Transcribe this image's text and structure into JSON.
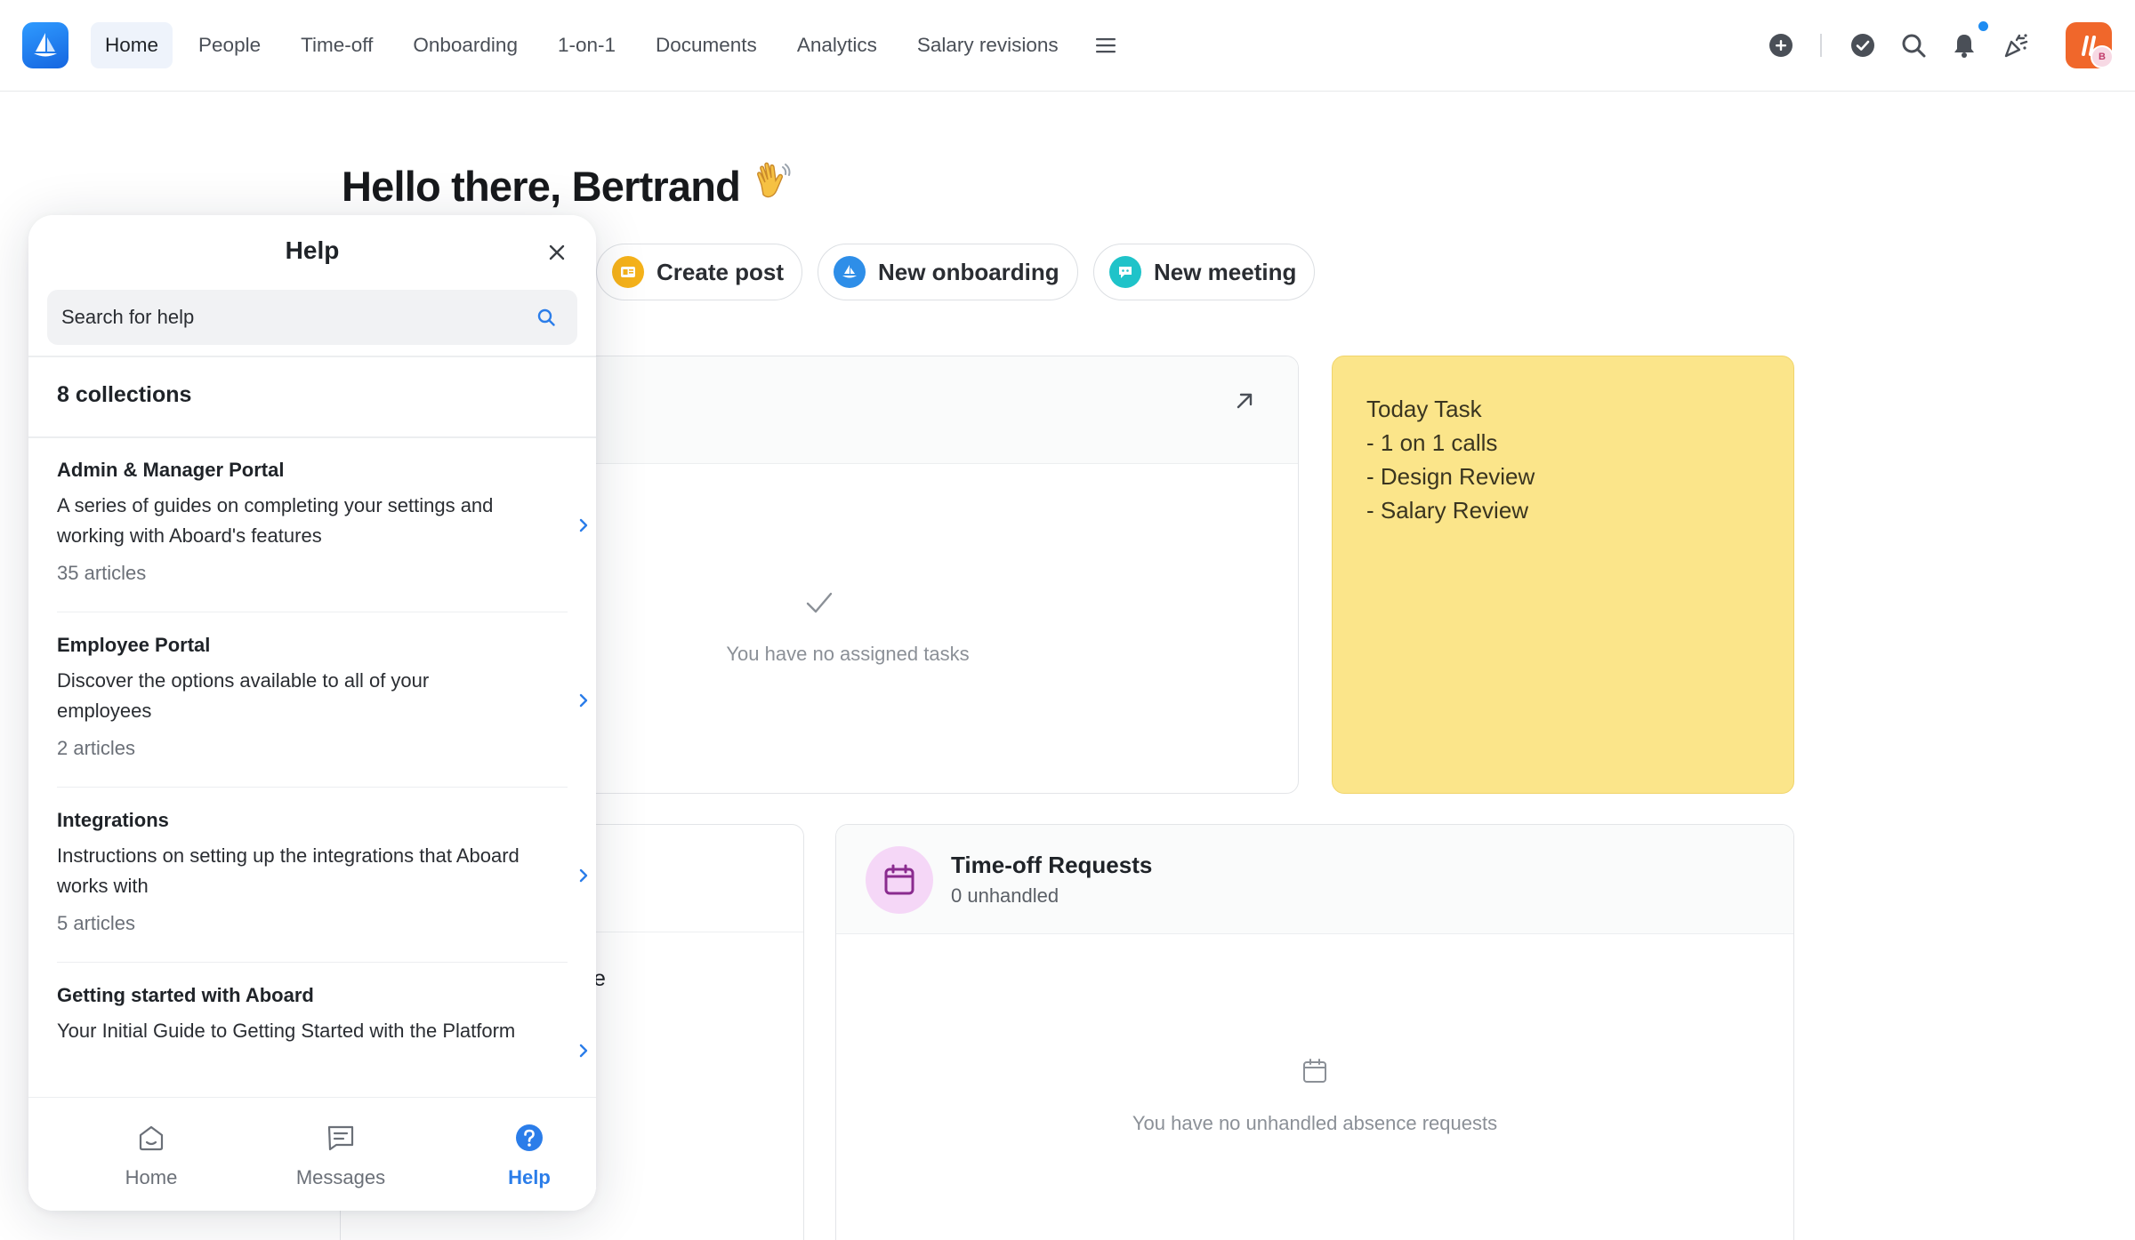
{
  "nav": {
    "items": [
      {
        "label": "Home",
        "active": true
      },
      {
        "label": "People",
        "active": false
      },
      {
        "label": "Time-off",
        "active": false
      },
      {
        "label": "Onboarding",
        "active": false
      },
      {
        "label": "1-on-1",
        "active": false
      },
      {
        "label": "Documents",
        "active": false
      },
      {
        "label": "Analytics",
        "active": false
      },
      {
        "label": "Salary revisions",
        "active": false
      }
    ],
    "icons": [
      "plus-circle-icon",
      "check-circle-icon",
      "search-icon",
      "bell-icon",
      "party-icon"
    ],
    "avatar_badge": "B",
    "accent": "#1e8cf2"
  },
  "main": {
    "greeting": "Hello there, Bertrand",
    "actions": [
      {
        "label": "Create post",
        "icon": "post-icon",
        "color": "#f5b21a"
      },
      {
        "label": "New onboarding",
        "icon": "onboarding-icon",
        "color": "#2e8ee8"
      },
      {
        "label": "New meeting",
        "icon": "meeting-icon",
        "color": "#1fc3c9"
      }
    ],
    "tasks_empty": "You have no assigned tasks",
    "note": {
      "lines": [
        "Today Task",
        "- 1 on 1 calls",
        "- Design Review",
        "- Salary Review"
      ],
      "color": "#fbe58a"
    },
    "partial_text": "e",
    "timeoff": {
      "title": "Time-off Requests",
      "subtitle": "0 unhandled",
      "empty": "You have no unhandled absence requests"
    }
  },
  "help": {
    "title": "Help",
    "search_placeholder": "Search for help",
    "collections_count": "8 collections",
    "collections": [
      {
        "title": "Admin & Manager Portal",
        "description": "A series of guides on completing your settings and working with Aboard's features",
        "count": "35 articles"
      },
      {
        "title": "Employee Portal",
        "description": "Discover the options available to all of your employees",
        "count": "2 articles"
      },
      {
        "title": "Integrations",
        "description": "Instructions on setting up the integrations that Aboard works with",
        "count": "5 articles"
      },
      {
        "title": "Getting started with Aboard",
        "description": "Your Initial Guide to Getting Started with the Platform",
        "count": ""
      }
    ],
    "tabs": [
      {
        "label": "Home",
        "icon": "home-icon",
        "active": false
      },
      {
        "label": "Messages",
        "icon": "messages-icon",
        "active": false
      },
      {
        "label": "Help",
        "icon": "help-icon",
        "active": true
      }
    ],
    "accent": "#2b7de9"
  }
}
